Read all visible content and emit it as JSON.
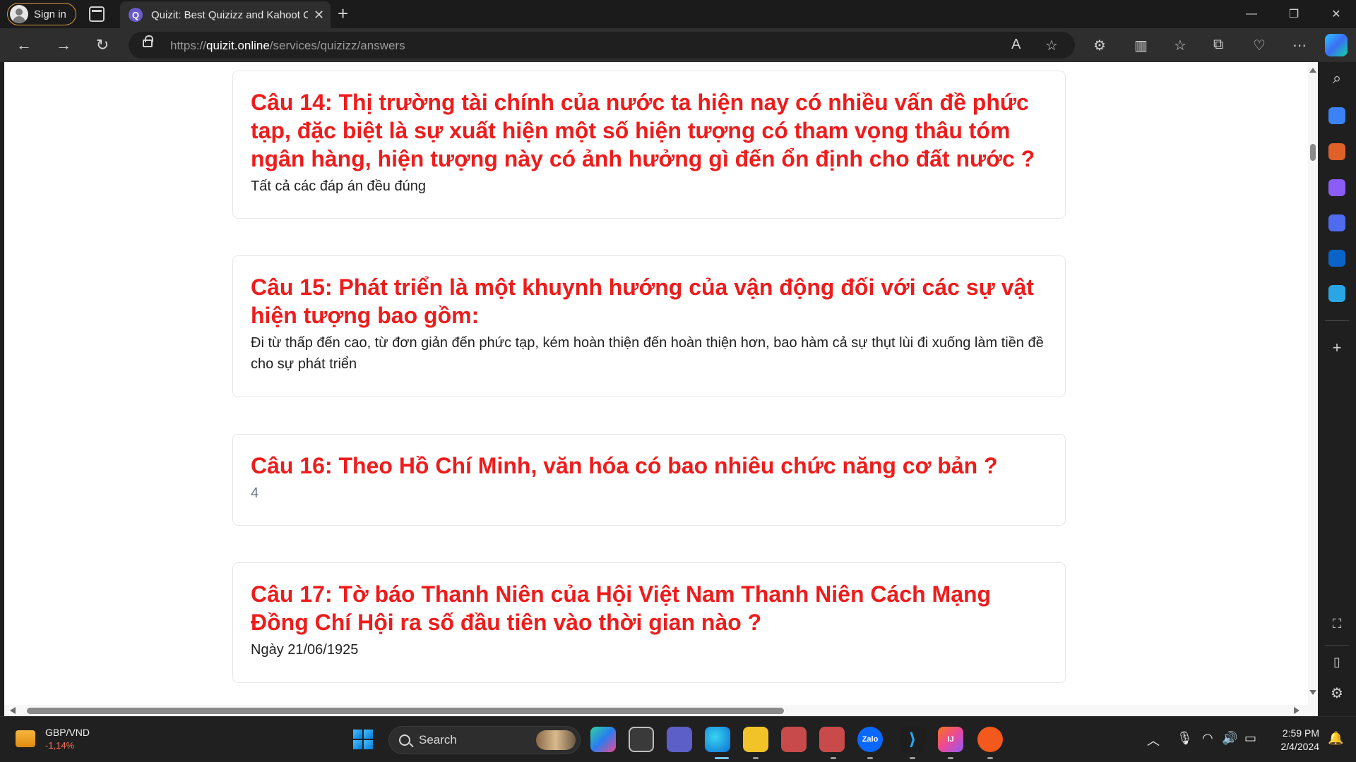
{
  "browser": {
    "signin_label": "Sign in",
    "tab_title": "Quizit: Best Quizizz and Kahoot C",
    "url_prefix": "https://",
    "url_host": "quizit.online",
    "url_path": "/services/quizizz/answers"
  },
  "questions": [
    {
      "title": "Câu 14: Thị trường tài chính của nước ta hiện nay có nhiều vấn đề phức tạp, đặc biệt là sự xuất hiện một số hiện tượng có tham vọng thâu tóm ngân hàng, hiện tượng này có ảnh hưởng gì đến ổn định cho đất nước ?",
      "answer": "Tất cả các đáp án đều đúng"
    },
    {
      "title": "Câu 15: Phát triển là một khuynh hướng của vận động đối với các sự vật hiện tượng bao gồm:",
      "answer": "Đi từ thấp đến cao, từ đơn giản đến phức tạp, kém hoàn thiện đến hoàn thiện hơn, bao hàm cả sự thụt lùi đi xuống làm tiền đề cho sự phát triển"
    },
    {
      "title": "Câu 16: Theo Hồ Chí Minh, văn hóa có bao nhiêu chức năng cơ bản ?",
      "answer": "4"
    },
    {
      "title": "Câu 17: Tờ báo Thanh Niên của Hội Việt Nam Thanh Niên Cách Mạng Đồng Chí Hội ra số đầu tiên vào thời gian nào ?",
      "answer": "Ngày 21/06/1925"
    }
  ],
  "taskbar": {
    "widget_name": "GBP/VND",
    "widget_value": "-1,14%",
    "search_label": "Search",
    "time": "2:59 PM",
    "date": "2/4/2024"
  },
  "colors": {
    "question_red": "#ee1c1c",
    "browser_dark": "#1b1b1b"
  }
}
